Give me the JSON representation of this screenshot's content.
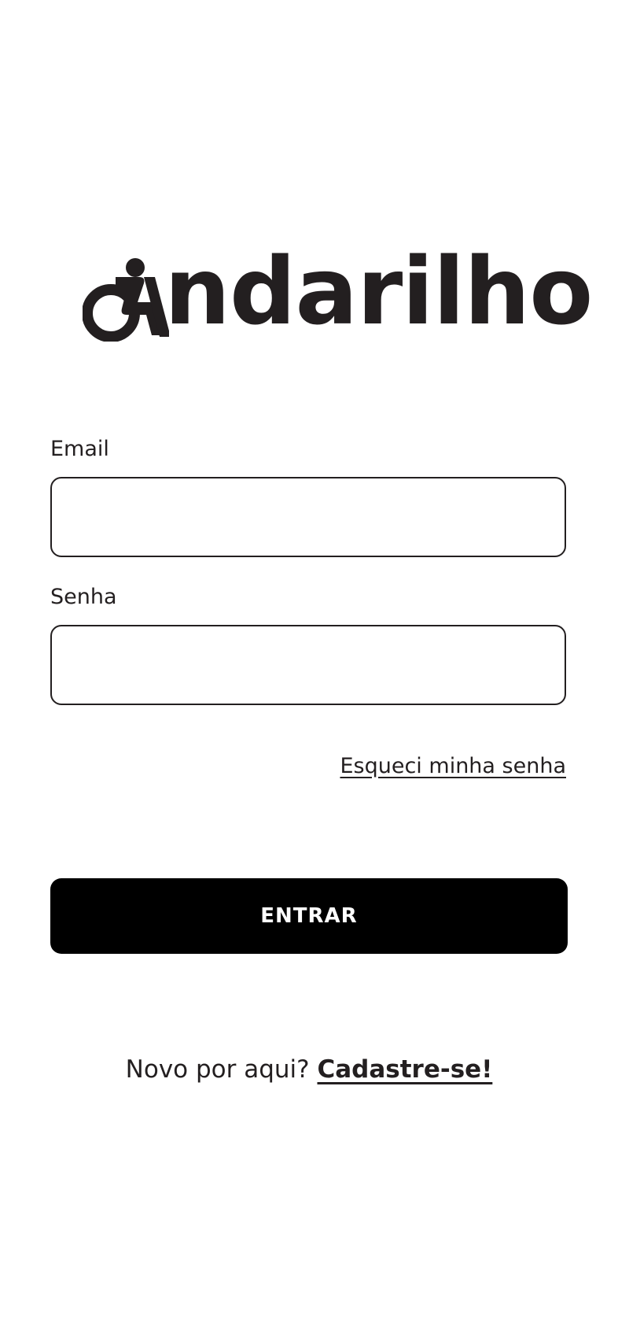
{
  "logo": {
    "icon": "wheelchair-symbol-icon",
    "text": "ndarilho"
  },
  "form": {
    "email": {
      "label": "Email",
      "value": "",
      "placeholder": ""
    },
    "password": {
      "label": "Senha",
      "value": "",
      "placeholder": ""
    },
    "forgot_label": "Esqueci minha senha",
    "submit_label": "ENTRAR"
  },
  "signup": {
    "prompt": "Novo por aqui?",
    "link_label": "Cadastre-se!"
  },
  "colors": {
    "text": "#231f20",
    "button_bg": "#000000",
    "button_text": "#ffffff",
    "background": "#ffffff"
  }
}
